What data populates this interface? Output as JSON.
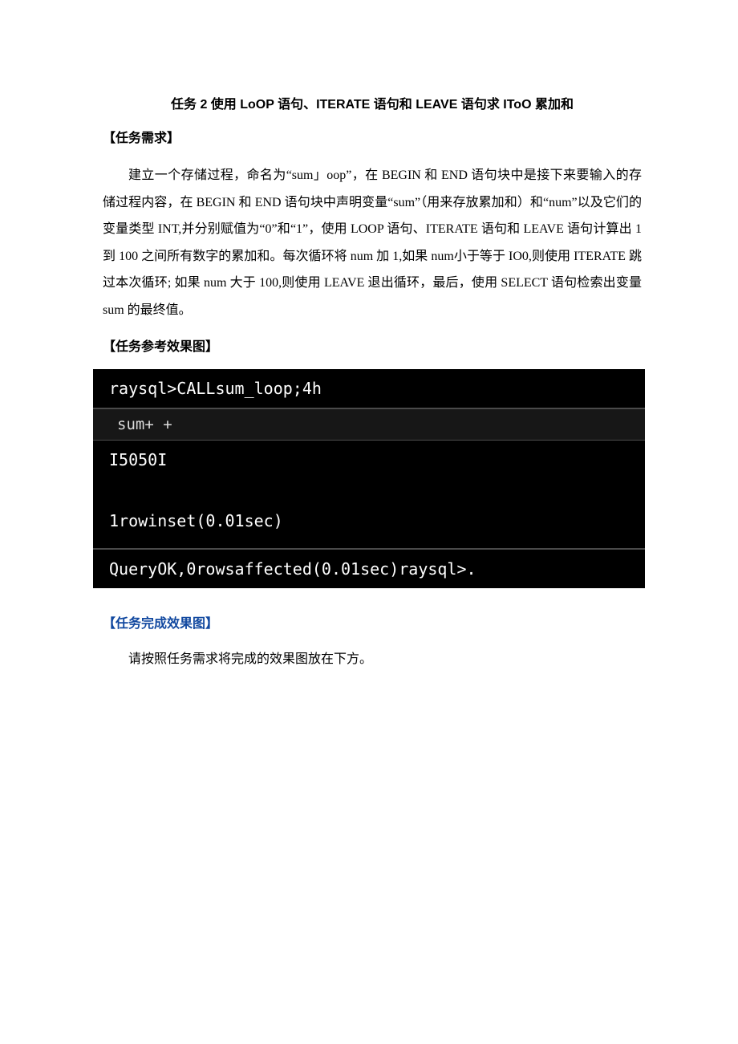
{
  "title": "任务 2 使用 LoOP 语句、ITERATE 语句和 LEAVE 语句求 IToO 累加和",
  "section1_heading": "【任务需求】",
  "body_paragraph": "建立一个存储过程，命名为“sum」oop”，在 BEGIN 和 END 语句块中是接下来要输入的存储过程内容，在 BEGIN 和 END 语句块中声明变量“sum”（用来存放累加和）和“num”以及它们的变量类型 INT,并分别赋值为“0”和“1”，使用 LOOP 语句、ITERATE 语句和 LEAVE 语句计算出 1 到 100 之间所有数字的累加和。每次循环将 num 加 1,如果 num小于等于 IO0,则使用 ITERATE 跳过本次循环; 如果 num 大于 100,则使用 LEAVE 退出循环，最后，使用 SELECT 语句检索出变量 sum 的最终值。",
  "section2_heading": "【任务参考效果图】",
  "console": {
    "line_prompt": "raysql>CALLsum_loop;4h",
    "line_header": "sum+ +",
    "line_value": "I5050I",
    "line_rowset": "1rowinset(0.01sec)",
    "line_ok": "QueryOK,0rowsaffected(0.01sec)raysql>."
  },
  "section3_heading": "【任务完成效果图】",
  "final_paragraph": "请按照任务需求将完成的效果图放在下方。"
}
